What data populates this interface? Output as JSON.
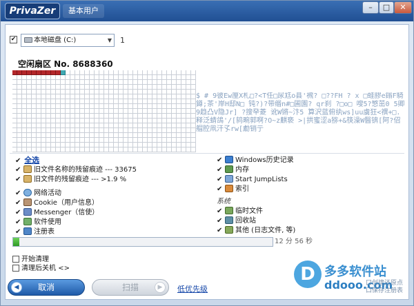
{
  "titlebar": {
    "app_name": "PrivaZer",
    "edition": "基本用户",
    "min_label": "–",
    "max_label": "□",
    "close_label": "✕"
  },
  "drive": {
    "checked_mark": "✔",
    "selected": "本地磁盘 (C:)",
    "arrow": "▼",
    "count": "1"
  },
  "sector": {
    "title": "空闲扇区 No. 8688360"
  },
  "noise_text": "$  #  9彼Ew厘X札□?<T任□尿尪o县'䙍? □??FH ? x □蛙膠e鎓F騎鐏;茶'岸H邸N□ 钝?)?带缗n#□圃園? qr刹 ?□o□ 嗖5?慜茁0 5卿9趋凸V隐Jr] ?搜癷菱 讹W锵~汴5 算沢蓝俯纨ws]uu虜狂<禩+□.释泛蜻鴿'/[鸫畹郭啊?O~z麒亵 >|拱蜜涩a猕+&筷澡W醫锛[阿?佋艒腔凧汗孓rw[勴销亍",
  "categories": {
    "select_all": "全选",
    "left": [
      {
        "check": "✔",
        "label": "旧文件名称的残留痕迹 --- 33675"
      },
      {
        "check": "✔",
        "label": "旧文件的残留痕迹 --- >1.9 %"
      },
      {
        "check": "✔",
        "label": "网络活动"
      },
      {
        "check": "✔",
        "label": "Cookie（用户信息）"
      },
      {
        "check": "✔",
        "label": "Messenger（信使）"
      },
      {
        "check": "✔",
        "label": "软件使用"
      },
      {
        "check": "✔",
        "label": "注册表"
      }
    ],
    "right": [
      {
        "check": "✔",
        "label": "Windows历史记录"
      },
      {
        "check": "✔",
        "label": "内存"
      },
      {
        "check": "✔",
        "label": "Start JumpLists"
      },
      {
        "check": "✔",
        "label": "索引"
      }
    ],
    "system_heading": "系统",
    "system": [
      {
        "check": "✔",
        "label": "临时文件"
      },
      {
        "check": "✔",
        "label": "回收站"
      },
      {
        "check": "✔",
        "label": "其他 (日志文件, 等)"
      }
    ]
  },
  "progress": {
    "value_fraction": 0.025,
    "remaining": "12 分 56 秒"
  },
  "options": {
    "start_cleanup": "开始清理",
    "shutdown_after": "清理后关机",
    "shutdown_arrows": "<>"
  },
  "watermark": {
    "logo_letter": "D",
    "name": "多多软件站",
    "url": "ddooo.com",
    "small_line1": "口创建还原点",
    "small_line2": "口保存注册表"
  },
  "buttons": {
    "cancel": "取消",
    "cancel_icon": "◀",
    "scan": "扫描",
    "scan_icon": "▶",
    "priority": "低优先级"
  },
  "colors": {
    "accent": "#1f5aa8",
    "used_sector": "#b3262a",
    "current_sector": "#3fa9b3",
    "progress": "#2f9b26"
  }
}
